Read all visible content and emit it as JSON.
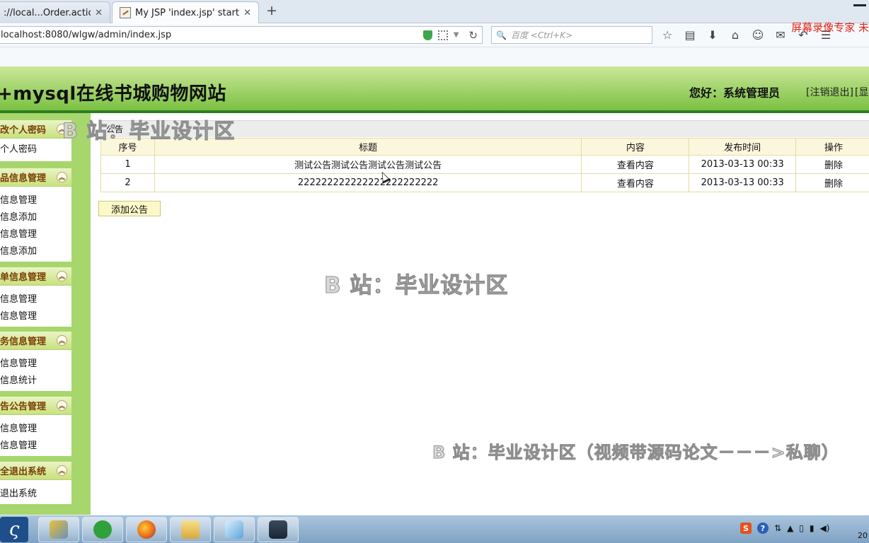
{
  "browser": {
    "tabs": [
      {
        "title": "://local...Order.action"
      },
      {
        "title": "My JSP 'index.jsp' startin..."
      }
    ],
    "new_tab": "+",
    "address": "localhost:8080/wlgw/admin/index.jsp",
    "search_placeholder": "百度 <Ctrl+K>",
    "recorder_label": "屏幕录像专家 未"
  },
  "header": {
    "site_title": "+mysql在线书城购物网站",
    "greeting": "您好：系统管理员",
    "logout": "[注销退出]",
    "show": "[显"
  },
  "sidebar": {
    "groups": [
      {
        "title": "改个人密码",
        "items": [
          "个人密码"
        ]
      },
      {
        "title": "品信息管理",
        "items": [
          "信息管理",
          "信息添加",
          "信息管理",
          "信息添加"
        ]
      },
      {
        "title": "单信息管理",
        "items": [
          "信息管理",
          "信息管理"
        ]
      },
      {
        "title": "务信息管理",
        "items": [
          "信息管理",
          "信息统计"
        ]
      },
      {
        "title": "告公告管理",
        "items": [
          "信息管理",
          "信息管理"
        ]
      },
      {
        "title": "全退出系统",
        "items": [
          "退出系统"
        ]
      }
    ]
  },
  "main": {
    "panel_title": "公告",
    "columns": [
      "序号",
      "标题",
      "内容",
      "发布时间",
      "操作"
    ],
    "rows": [
      {
        "no": "1",
        "title": "测试公告测试公告测试公告测试公告",
        "content": "查看内容",
        "time": "2013-03-13 00:33",
        "op": "删除"
      },
      {
        "no": "2",
        "title": "222222222222222222222222",
        "content": "查看内容",
        "time": "2013-03-13 00:33",
        "op": "删除"
      }
    ],
    "add_button": "添加公告"
  },
  "watermarks": [
    "B 站：毕业设计区",
    "B 站：毕业设计区",
    "B 站：毕业设计区（视频带源码论文－－－>私聊）"
  ],
  "taskbar": {
    "clock": "20"
  },
  "colors": {
    "header_green": "#7bc142",
    "sidebar_green": "#a7d66d",
    "menu_head_text": "#7a3c05",
    "table_border": "#e3dba8",
    "recorder_red": "#e2231a"
  }
}
